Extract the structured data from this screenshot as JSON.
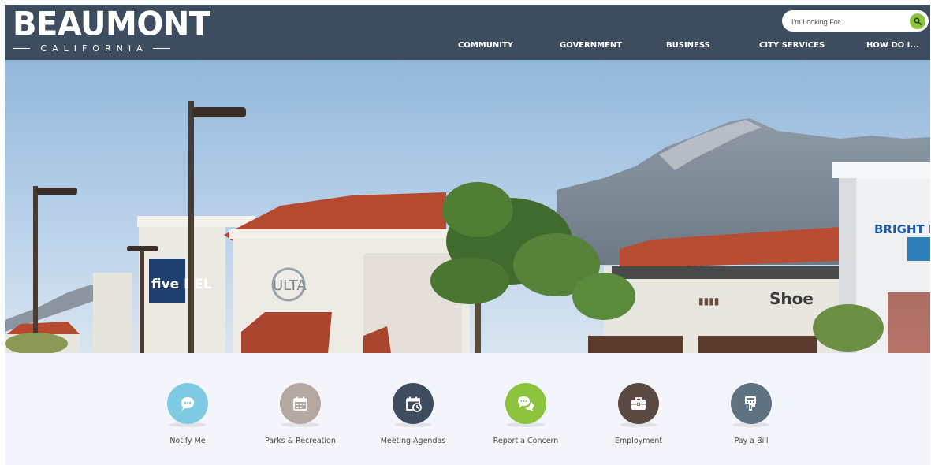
{
  "header": {
    "logo": {
      "name": "BEAUMONT",
      "subtitle": "CALIFORNIA"
    },
    "search": {
      "placeholder": "I'm Looking For..."
    },
    "nav": [
      {
        "label": "COMMUNITY"
      },
      {
        "label": "GOVERNMENT"
      },
      {
        "label": "BUSINESS"
      },
      {
        "label": "CITY SERVICES"
      },
      {
        "label": "HOW DO I..."
      }
    ]
  },
  "hero": {
    "store_signs": [
      "five BEL",
      "ULTA",
      "BRIGHT N",
      "Shoe"
    ]
  },
  "quick_links": [
    {
      "label": "Notify Me",
      "icon": "chat-bubble-icon",
      "color": "#7fcbe3"
    },
    {
      "label": "Parks & Recreation",
      "icon": "calendar-icon",
      "color": "#b5a89e"
    },
    {
      "label": "Meeting Agendas",
      "icon": "calendar-clock-icon",
      "color": "#3d4d5f"
    },
    {
      "label": "Report a Concern",
      "icon": "speech-bubbles-icon",
      "color": "#8cc43e"
    },
    {
      "label": "Employment",
      "icon": "briefcase-icon",
      "color": "#5b4a42"
    },
    {
      "label": "Pay a Bill",
      "icon": "payment-terminal-icon",
      "color": "#5e7282"
    }
  ],
  "colors": {
    "header_bg": "#3d4d5f",
    "accent_green": "#8cc43e",
    "quick_bg": "#f4f5fb"
  }
}
